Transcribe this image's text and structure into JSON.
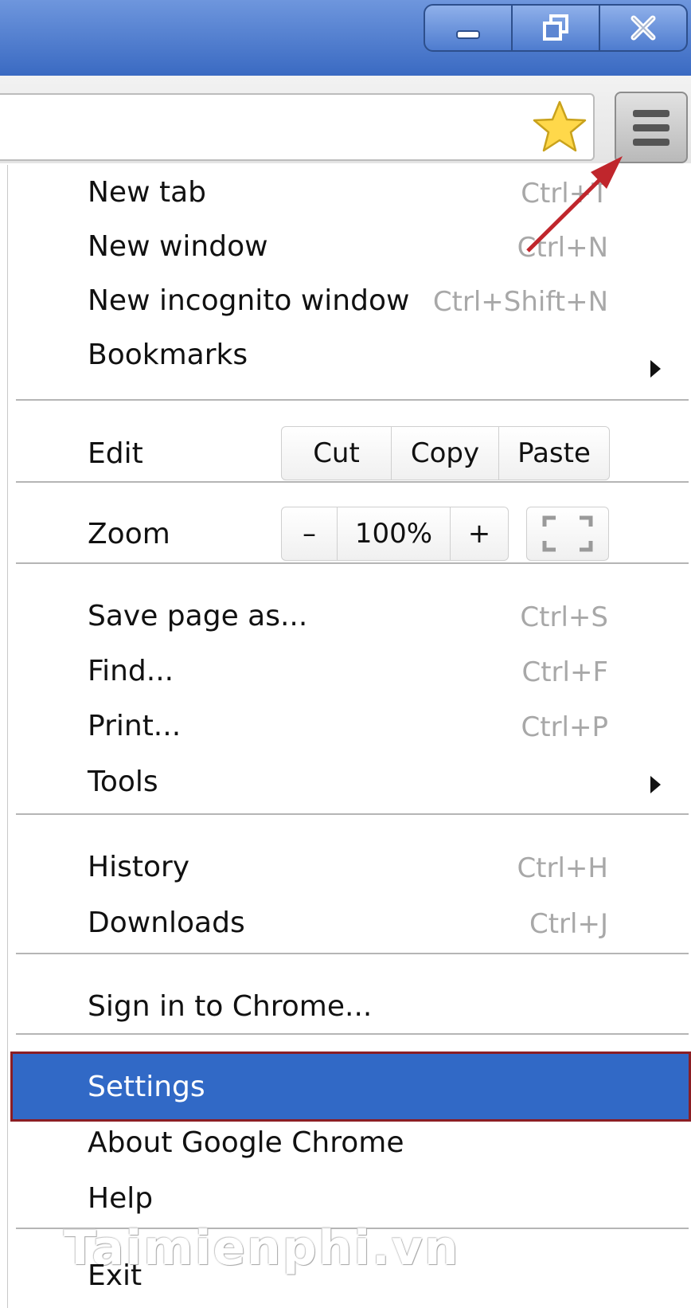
{
  "window_controls": {
    "minimize_icon": "minimize-icon",
    "restore_icon": "restore-icon",
    "close_icon": "close-icon"
  },
  "toolbar": {
    "bookmark_star_icon": "star-icon",
    "menu_icon": "hamburger-menu-icon"
  },
  "menu": {
    "new_tab": {
      "label": "New tab",
      "shortcut": "Ctrl+T"
    },
    "new_window": {
      "label": "New window",
      "shortcut": "Ctrl+N"
    },
    "new_incognito": {
      "label": "New incognito window",
      "shortcut": "Ctrl+Shift+N"
    },
    "bookmarks": {
      "label": "Bookmarks"
    },
    "edit": {
      "label": "Edit",
      "cut": "Cut",
      "copy": "Copy",
      "paste": "Paste"
    },
    "zoom": {
      "label": "Zoom",
      "minus": "–",
      "value": "100%",
      "plus": "+"
    },
    "save_page": {
      "label": "Save page as...",
      "shortcut": "Ctrl+S"
    },
    "find": {
      "label": "Find...",
      "shortcut": "Ctrl+F"
    },
    "print": {
      "label": "Print...",
      "shortcut": "Ctrl+P"
    },
    "tools": {
      "label": "Tools"
    },
    "history": {
      "label": "History",
      "shortcut": "Ctrl+H"
    },
    "downloads": {
      "label": "Downloads",
      "shortcut": "Ctrl+J"
    },
    "sign_in": {
      "label": "Sign in to Chrome..."
    },
    "settings": {
      "label": "Settings"
    },
    "about": {
      "label": "About Google Chrome"
    },
    "help": {
      "label": "Help"
    },
    "exit": {
      "label": "Exit"
    }
  },
  "watermark": "Taimienphi.vn",
  "colors": {
    "selection": "#3169c6",
    "highlight_border": "#8b1e24",
    "annotation_arrow": "#c0262c",
    "titlebar": "#3a6ac2"
  }
}
